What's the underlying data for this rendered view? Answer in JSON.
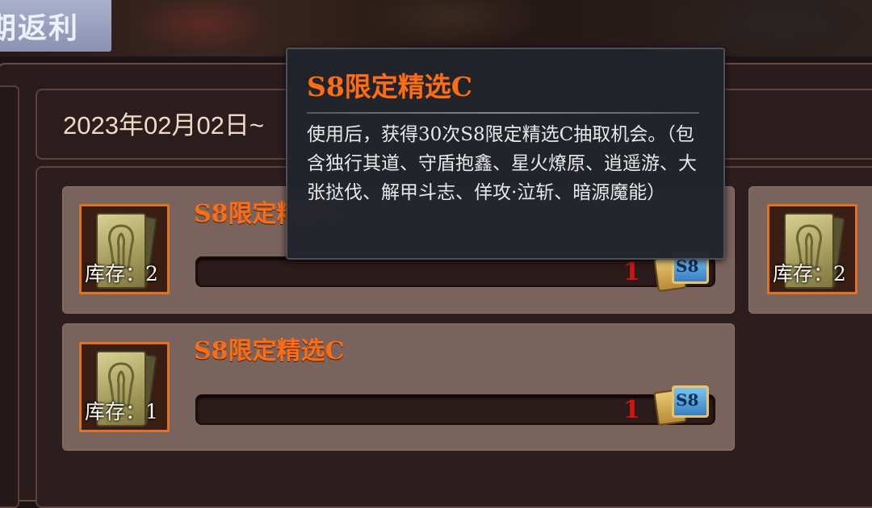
{
  "event": {
    "title": "期返利"
  },
  "date_range": "2023年02月02日~",
  "items": [
    {
      "name": "S8限定精选C",
      "stock": "库存：2",
      "progress_value": "1",
      "reward_token": "S8"
    },
    {
      "name": "S8限定精选C",
      "stock": "库存：1",
      "progress_value": "1",
      "reward_token": "S8"
    },
    {
      "stock": "库存：2"
    }
  ],
  "tooltip": {
    "title": "S8限定精选C",
    "description": "使用后，获得30次S8限定精选C抽取机会。（包含独行其道、守盾抱鑫、星火燎原、逍遥游、大张挞伐、解甲斗志、佯攻·泣斩、暗源魔能）"
  },
  "colors": {
    "item_name": "#ff6d12",
    "progress_value": "#d21414",
    "icon_border": "#e0741e",
    "tooltip_bg": "#21242b"
  },
  "icons": {
    "item_icon": "card-pack-icon",
    "reward_icon": "s8-ticket-icon"
  }
}
